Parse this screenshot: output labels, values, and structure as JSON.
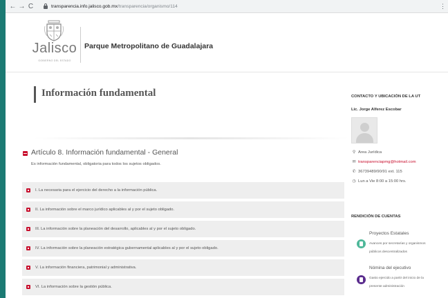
{
  "browser": {
    "url_domain": "transparencia.info.jalisco.gob.mx",
    "url_path": "/transparencia/organismo/114"
  },
  "header": {
    "logo_text": "Jalisco",
    "logo_subtext": "GOBIERNO DEL ESTADO",
    "site_title": "Parque Metropolitano de Guadalajara"
  },
  "main": {
    "page_title": "Información fundamental",
    "section": {
      "title": "Artículo 8. Información fundamental - General",
      "description": "Es información fundamental, obligatoria para todos los sujetos obligados."
    },
    "items": [
      {
        "label": "I. La necesaria para el ejercicio del derecho a la información pública."
      },
      {
        "label": "II. La información sobre el marco jurídico aplicables al y por el sujeto obligado."
      },
      {
        "label": "III. La información sobre la planeación del desarrollo, aplicables al y por el sujeto obligado."
      },
      {
        "label": "IV. La información sobre la planeación estratégica gubernamental aplicables al y por el sujeto obligado."
      },
      {
        "label": "V. La información financiera, patrimonial y administrativa."
      },
      {
        "label": "VI. La información sobre la gestión pública."
      }
    ]
  },
  "sidebar": {
    "contact_heading": "CONTACTO Y UBICACIÓN DE LA UT",
    "contact_name": "Lic. Jorge Alferez Escobar",
    "contact_area": "Area Jurídica",
    "contact_email": "transparenciapmg@hotmail.com",
    "contact_phone": "36739489/90/91 ext. 115",
    "contact_hours": "Lun a Vie 8:00 a 15:00 hrs.",
    "accounts_heading": "RENDICIÓN DE CUENTAS",
    "accounts": [
      {
        "title": "Proyectos Estatales",
        "desc_line1": "Avances por secretarías y organismos",
        "desc_line2": "públicos descentralizados",
        "color": "#4fb89a"
      },
      {
        "title": "Nómina del ejecutivo",
        "desc_line1": "Gasto ejercido a partir del inicio de la",
        "desc_line2": "presente administración",
        "color": "#5b2d8e"
      }
    ]
  },
  "colors": {
    "accent_red": "#c8102e",
    "frame_teal": "#1b7a73"
  }
}
